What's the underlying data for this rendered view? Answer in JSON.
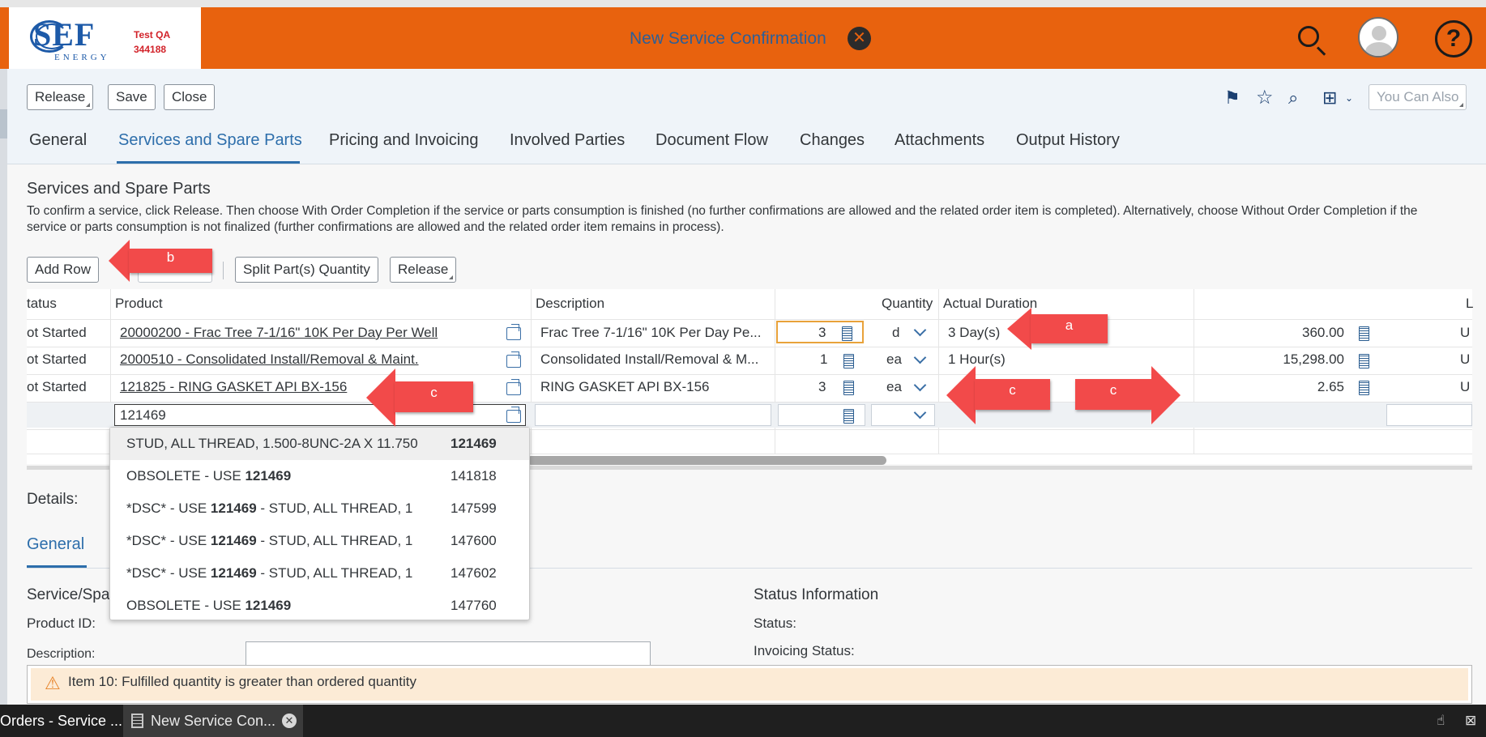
{
  "shell": {
    "logo_text": "SEF",
    "logo_sub": "ENERGY",
    "env_line1": "Test QA",
    "env_line2": "344188",
    "title": "New Service Confirmation"
  },
  "toolbar": {
    "release": "Release",
    "save": "Save",
    "close": "Close",
    "you_can_also": "You Can Also"
  },
  "tabs": [
    {
      "label": "General"
    },
    {
      "label": "Services and Spare Parts"
    },
    {
      "label": "Pricing and Invoicing"
    },
    {
      "label": "Involved Parties"
    },
    {
      "label": "Document Flow"
    },
    {
      "label": "Changes"
    },
    {
      "label": "Attachments"
    },
    {
      "label": "Output History"
    }
  ],
  "section": {
    "title": "Services and Spare Parts",
    "description": "To confirm a service, click Release. Then choose With Order Completion if the service or parts consumption is finished (no further confirmations are allowed and the related order item is completed). Alternatively, choose Without Order Completion if the service or parts consumption is not finalized (further confirmations are allowed and the related order item remains in process)."
  },
  "table_toolbar": {
    "add_row": "Add Row",
    "split": "Split Part(s) Quantity",
    "release": "Release"
  },
  "columns": {
    "status": "tatus",
    "product": "Product",
    "description": "Description",
    "quantity": "Quantity",
    "actual_duration": "Actual Duration",
    "last": "L"
  },
  "rows": [
    {
      "status": "ot Started",
      "product": "20000200 - Frac Tree 7-1/16\" 10K Per Day Per Well",
      "description": "Frac Tree 7-1/16\" 10K Per Day Pe...",
      "qty": "3",
      "unit": "d",
      "duration": "3 Day(s)",
      "amount": "360.00",
      "last": "U"
    },
    {
      "status": "ot Started",
      "product": "2000510 - Consolidated Install/Removal & Maint.",
      "description": "Consolidated Install/Removal & M...",
      "qty": "1",
      "unit": "ea",
      "duration": "1 Hour(s)",
      "amount": "15,298.00",
      "last": "U"
    },
    {
      "status": "ot Started",
      "product": "121825 - RING GASKET API BX-156",
      "description": "RING GASKET API BX-156",
      "qty": "3",
      "unit": "ea",
      "duration": "",
      "amount": "2.65",
      "last": "U"
    }
  ],
  "new_row": {
    "product_input": "121469"
  },
  "suggestions": [
    {
      "pre": "STUD, ALL THREAD, 1.500-8UNC-2A X 11.750",
      "bold": "",
      "post": "",
      "code": "121469",
      "code_bold": true
    },
    {
      "pre": "OBSOLETE - USE ",
      "bold": "121469",
      "post": "",
      "code": "141818",
      "code_bold": false
    },
    {
      "pre": "*DSC* - USE ",
      "bold": "121469",
      "post": " - STUD, ALL THREAD, 1",
      "code": "147599",
      "code_bold": false
    },
    {
      "pre": "*DSC* - USE ",
      "bold": "121469",
      "post": " - STUD, ALL THREAD, 1",
      "code": "147600",
      "code_bold": false
    },
    {
      "pre": "*DSC* - USE ",
      "bold": "121469",
      "post": " - STUD, ALL THREAD, 1",
      "code": "147602",
      "code_bold": false
    },
    {
      "pre": "OBSOLETE - USE ",
      "bold": "121469",
      "post": "",
      "code": "147760",
      "code_bold": false
    }
  ],
  "callouts": {
    "a": "a",
    "b": "b",
    "c": "c"
  },
  "details": {
    "title": "Details:",
    "tab_general": "General",
    "section_left": "Service/Spa",
    "product_id": "Product ID:",
    "description": "Description:",
    "status_info": "Status Information",
    "status": "Status:",
    "invoicing_status": "Invoicing Status:"
  },
  "message": "Item 10: Fulfilled quantity is greater than ordered quantity",
  "taskbar": {
    "task1": "Orders - Service ...",
    "task2": "New Service Con..."
  },
  "colors": {
    "shell": "#e8620e",
    "accent": "#2d6eab",
    "callout": "#f24a4a"
  }
}
